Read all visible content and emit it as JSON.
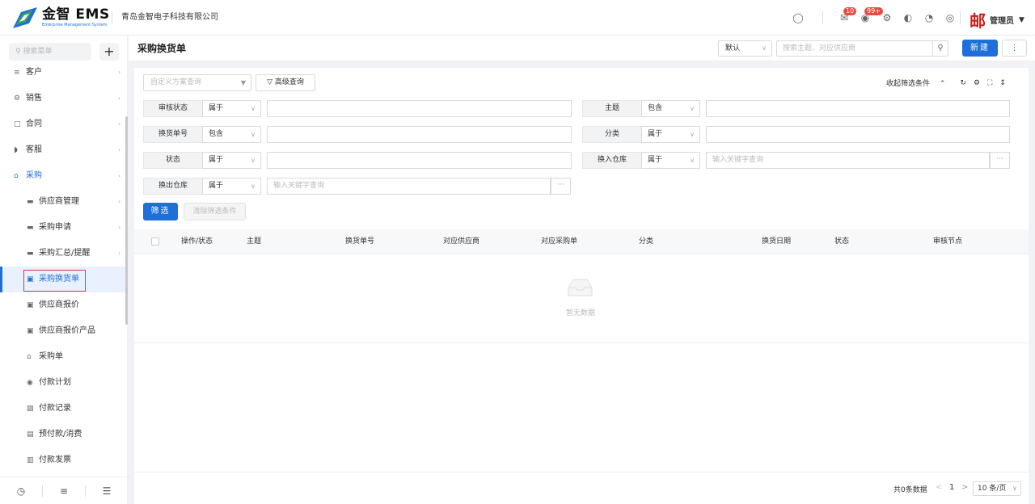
{
  "app": {
    "logo_text": "金智 EMS",
    "logo_subtext": "Enterprise Management System",
    "company": "青岛金智电子科技有限公司",
    "mail_badge": "10",
    "bell_badge": "99+",
    "user_name": "管理员",
    "user_avatar_char": "邮"
  },
  "sidebar": {
    "search_placeholder": "搜索菜单",
    "plus": "+",
    "items": [
      {
        "label": "客户",
        "icon": "chart-icon",
        "glyph": "≡",
        "arrow": "›"
      },
      {
        "label": "销售",
        "icon": "gear-icon",
        "glyph": "⚙",
        "arrow": "›"
      },
      {
        "label": "合同",
        "icon": "document-icon",
        "glyph": "□",
        "arrow": "›"
      },
      {
        "label": "客服",
        "icon": "headset-icon",
        "glyph": "◗",
        "arrow": "›"
      },
      {
        "label": "采购",
        "icon": "cart-icon",
        "glyph": "⌂",
        "arrow": "‹"
      },
      {
        "label": "供应商管理",
        "icon": "folder-icon",
        "glyph": "▬",
        "arrow": "›"
      },
      {
        "label": "采购申请",
        "icon": "folder-icon",
        "glyph": "▬",
        "arrow": "›"
      },
      {
        "label": "采购汇总/提醒",
        "icon": "folder-icon",
        "glyph": "▬",
        "arrow": "›"
      },
      {
        "label": "采购换货单",
        "icon": "exchange-icon",
        "glyph": "▣",
        "arrow": ""
      },
      {
        "label": "供应商报价",
        "icon": "quote-icon",
        "glyph": "▣",
        "arrow": ""
      },
      {
        "label": "供应商报价产品",
        "icon": "quote-product-icon",
        "glyph": "▣",
        "arrow": ""
      },
      {
        "label": "采购单",
        "icon": "basket-icon",
        "glyph": "⌂",
        "arrow": ""
      },
      {
        "label": "付款计划",
        "icon": "plan-icon",
        "glyph": "◉",
        "arrow": ""
      },
      {
        "label": "付款记录",
        "icon": "record-icon",
        "glyph": "▨",
        "arrow": ""
      },
      {
        "label": "预付款/消费",
        "icon": "prepay-icon",
        "glyph": "▤",
        "arrow": ""
      },
      {
        "label": "付款发票",
        "icon": "invoice-icon",
        "glyph": "▥",
        "arrow": ""
      }
    ]
  },
  "header": {
    "title": "采购换货单",
    "view_select": "默认",
    "search_placeholder": "搜索主题、对应供应商",
    "new_button": "新建",
    "more_button": "⋮"
  },
  "filter": {
    "scheme_placeholder": "自定义方案查询",
    "advanced_button": "高级查询",
    "collapse_label": "收起筛选条件",
    "rows": [
      {
        "label": "审核状态",
        "op": "属于",
        "value": ""
      },
      {
        "label": "主题",
        "op": "包含",
        "value": ""
      },
      {
        "label": "换货单号",
        "op": "包含",
        "value": ""
      },
      {
        "label": "分类",
        "op": "属于",
        "value": ""
      },
      {
        "label": "状态",
        "op": "属于",
        "value": ""
      },
      {
        "label": "换入仓库",
        "op": "属于",
        "value": "输入关键字查询"
      },
      {
        "label": "换出仓库",
        "op": "属于",
        "value": "输入关键字查询"
      }
    ],
    "filter_button": "筛选",
    "clear_button": "清除筛选条件",
    "dots": "···"
  },
  "table": {
    "columns": [
      "操作/状态",
      "主题",
      "换货单号",
      "对应供应商",
      "对应采购单",
      "分类",
      "换货日期",
      "状态",
      "审核节点"
    ],
    "empty_text": "暂无数据"
  },
  "pager": {
    "total": "共0条数据",
    "page": "1",
    "page_size": "10 条/页"
  },
  "colors": {
    "accent": "#1e6fd9",
    "highlight_box": "#d9363e",
    "badge": "#e84c3d"
  }
}
